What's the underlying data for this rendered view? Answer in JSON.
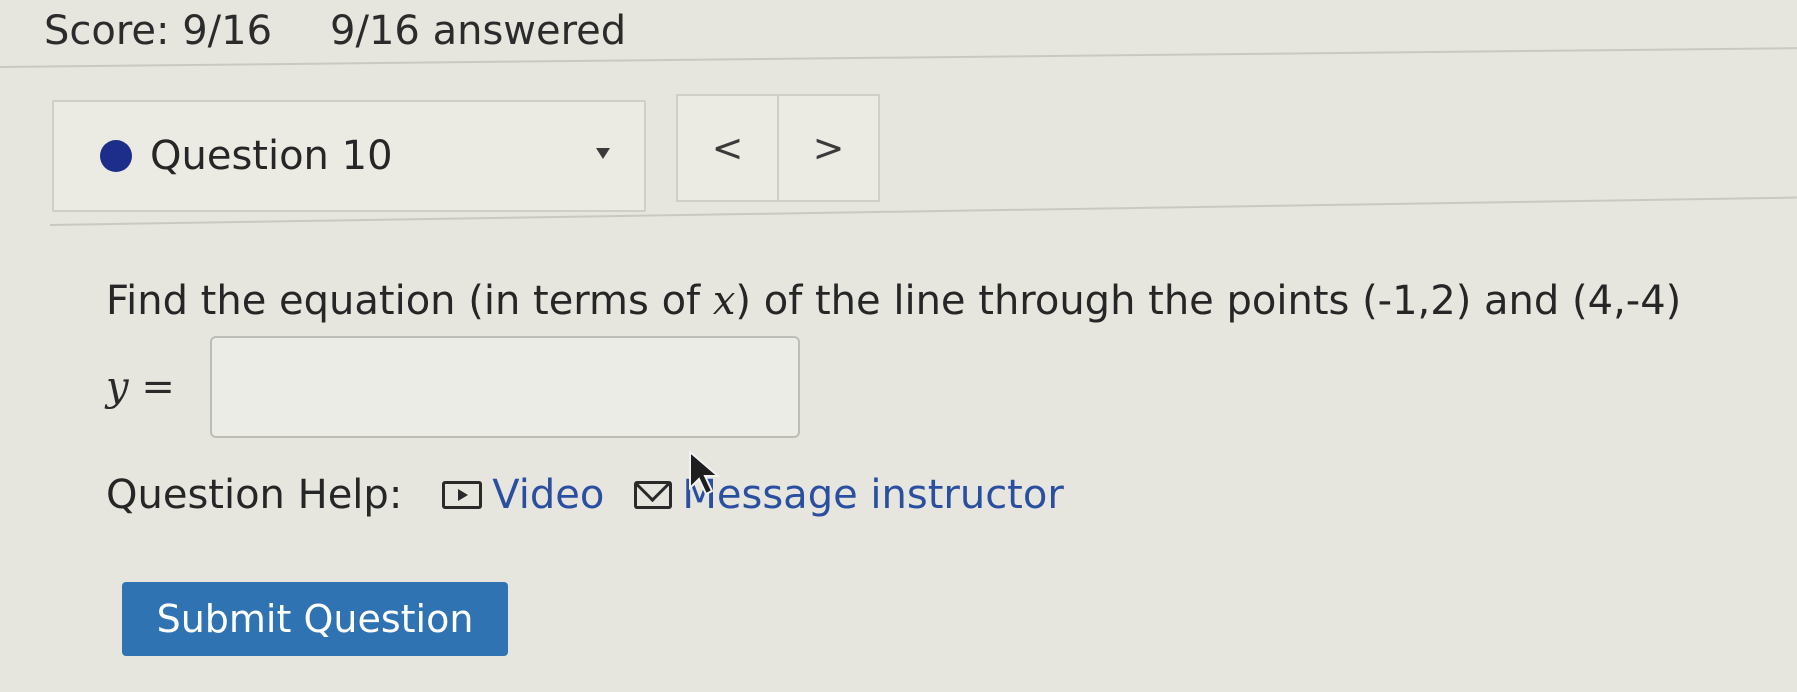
{
  "header": {
    "score": "Score: 9/16",
    "answered": "9/16 answered"
  },
  "question_select": {
    "label": "Question 10",
    "status_color": "#1d2e8a",
    "arrow_icon": "dropdown-arrow-icon"
  },
  "nav": {
    "prev_label": "<",
    "next_label": ">"
  },
  "question": {
    "prompt_before": "Find the equation (in terms of ",
    "prompt_var": "x",
    "prompt_after": ") of the line through the points (-1,2) and (4,-4)",
    "answer_label": "y =",
    "answer_value": "",
    "answer_placeholder": ""
  },
  "help": {
    "label": "Question Help:",
    "video_label": "Video",
    "video_icon": "video-icon",
    "message_label": "Message instructor",
    "message_icon": "mail-icon"
  },
  "submit": {
    "label": "Submit Question",
    "color": "#2f73b3"
  }
}
